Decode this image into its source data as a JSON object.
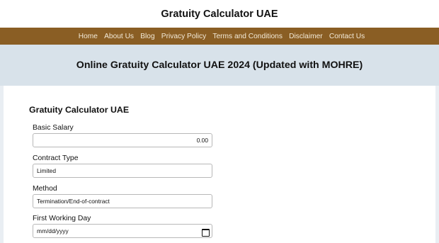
{
  "header": {
    "site_title": "Gratuity Calculator UAE"
  },
  "nav": {
    "items": [
      {
        "label": "Home"
      },
      {
        "label": "About Us"
      },
      {
        "label": "Blog"
      },
      {
        "label": "Privacy Policy"
      },
      {
        "label": "Terms and Conditions"
      },
      {
        "label": "Disclaimer"
      },
      {
        "label": "Contact Us"
      }
    ]
  },
  "hero": {
    "title": "Online Gratuity Calculator UAE 2024 (Updated with MOHRE)"
  },
  "calculator": {
    "title": "Gratuity Calculator UAE",
    "fields": {
      "basic_salary": {
        "label": "Basic Salary",
        "value": "0.00"
      },
      "contract_type": {
        "label": "Contract Type",
        "value": "Limited"
      },
      "method": {
        "label": "Method",
        "value": "Termination/End-of-contract"
      },
      "first_working_day": {
        "label": "First Working Day",
        "placeholder": "mm/dd/yyyy",
        "icon": "calendar-icon"
      }
    }
  },
  "colors": {
    "nav_bg": "#8a5e24",
    "nav_text": "#f3ead8",
    "hero_bg": "#d8e2ea",
    "page_bg": "#e9eef3"
  }
}
